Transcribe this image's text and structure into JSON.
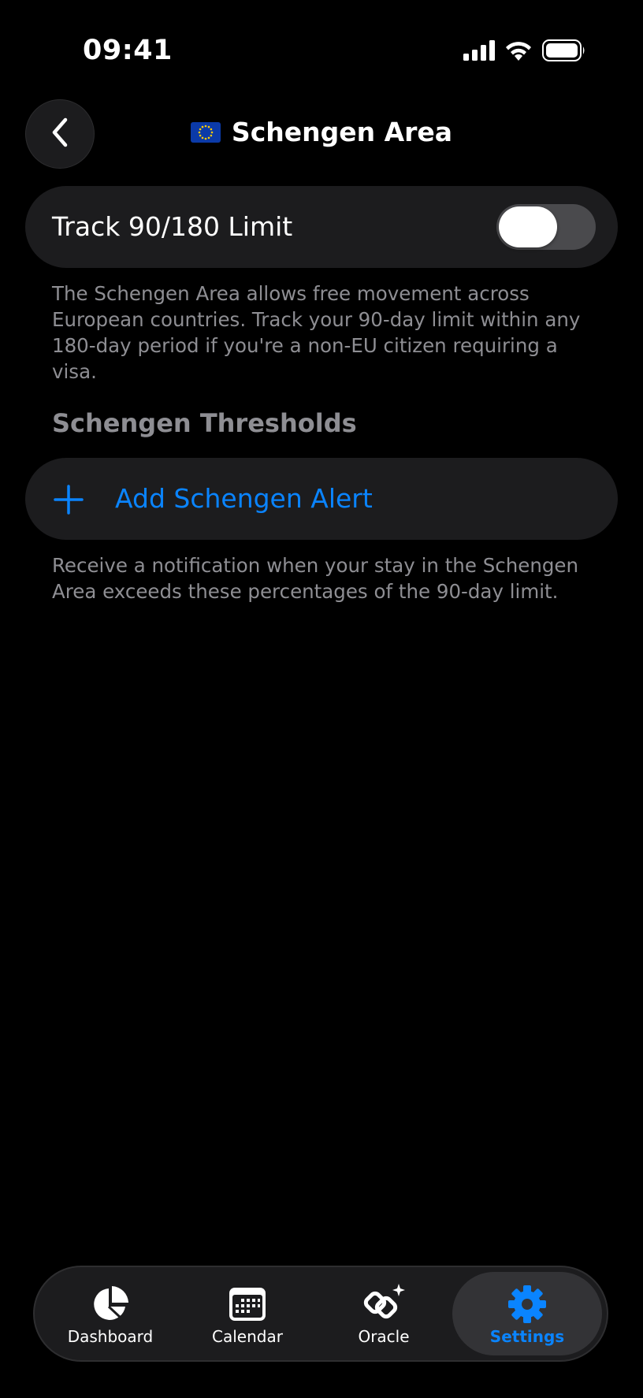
{
  "status_bar": {
    "time": "09:41"
  },
  "header": {
    "title": "Schengen Area",
    "flag_icon": "eu-flag-icon",
    "back_icon": "chevron-left-icon"
  },
  "track_setting": {
    "label": "Track 90/180 Limit",
    "enabled": false
  },
  "description": "The Schengen Area allows free movement across European countries. Track your 90-day limit within any 180-day period if you're a non-EU citizen requiring a visa.",
  "thresholds": {
    "section_title": "Schengen Thresholds",
    "add_label": "Add Schengen Alert",
    "footnote": "Receive a notification when your stay in the Schengen Area exceeds these percentages of the 90-day limit."
  },
  "tab_bar": {
    "tabs": [
      {
        "label": "Dashboard",
        "icon": "pie-chart-icon",
        "selected": false
      },
      {
        "label": "Calendar",
        "icon": "calendar-icon",
        "selected": false
      },
      {
        "label": "Oracle",
        "icon": "oracle-sparkle-icon",
        "selected": false
      },
      {
        "label": "Settings",
        "icon": "gear-icon",
        "selected": true
      }
    ]
  },
  "colors": {
    "accent": "#0a84ff",
    "background": "#000000",
    "card": "#1c1c1e",
    "secondary_text": "#8e8e93"
  }
}
